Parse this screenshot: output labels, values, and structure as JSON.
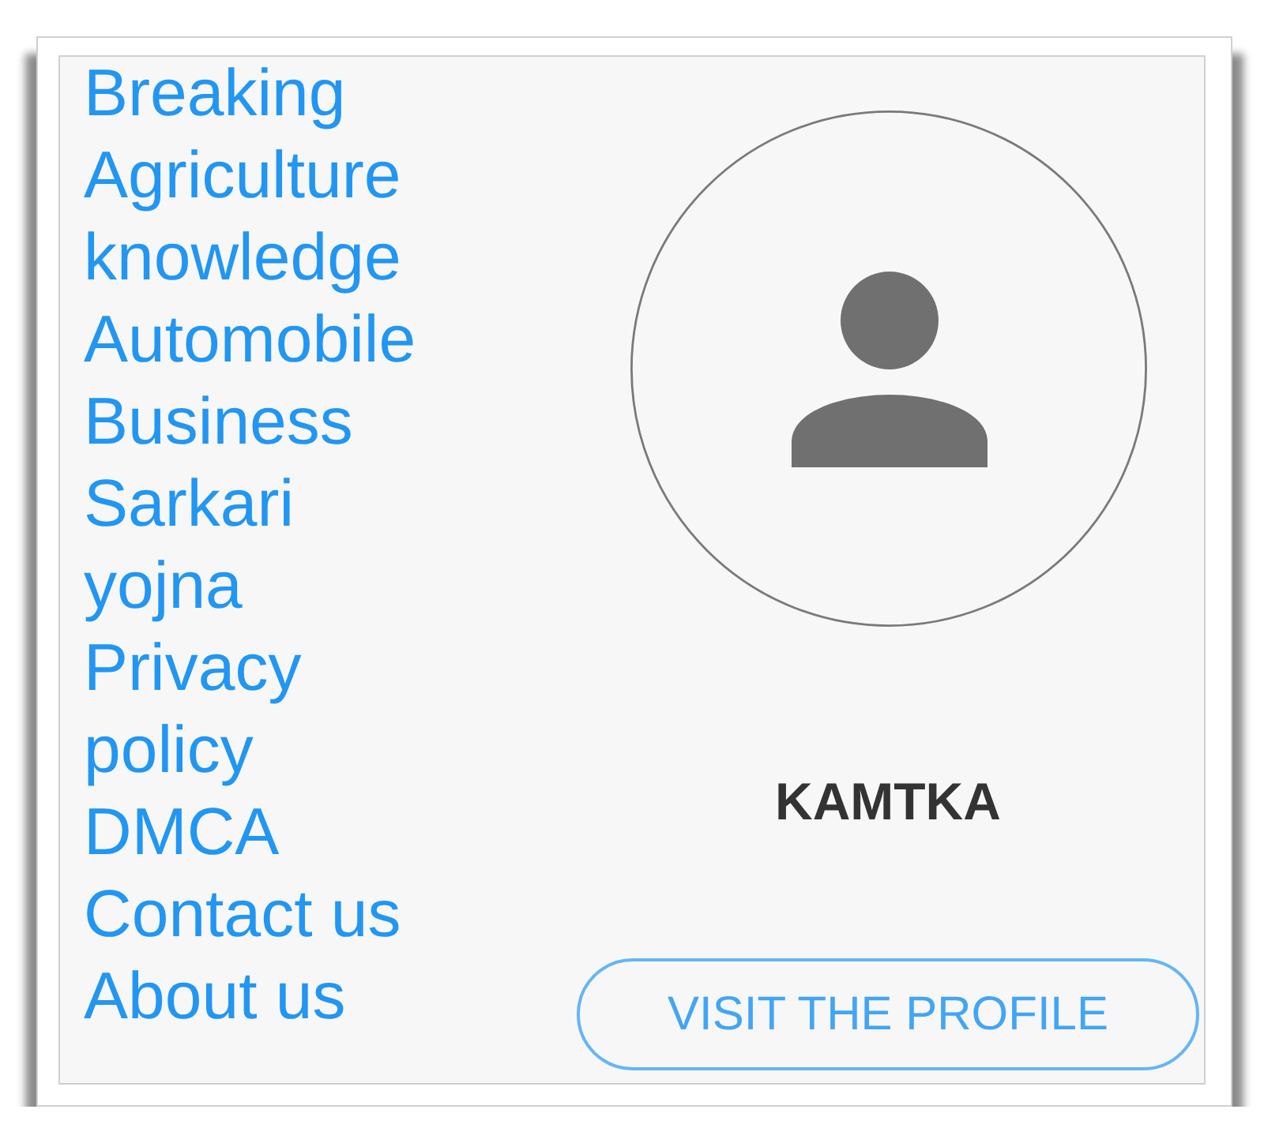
{
  "links": [
    {
      "label": "Breaking"
    },
    {
      "label": "Agriculture knowledge"
    },
    {
      "label": "Automobile"
    },
    {
      "label": "Business"
    },
    {
      "label": "Sarkari yojna"
    },
    {
      "label": "Privacy policy"
    },
    {
      "label": "DMCA"
    },
    {
      "label": "Contact us"
    },
    {
      "label": "About us"
    }
  ],
  "profile": {
    "name": "KAMTKA",
    "button": "VISIT THE PROFILE"
  }
}
